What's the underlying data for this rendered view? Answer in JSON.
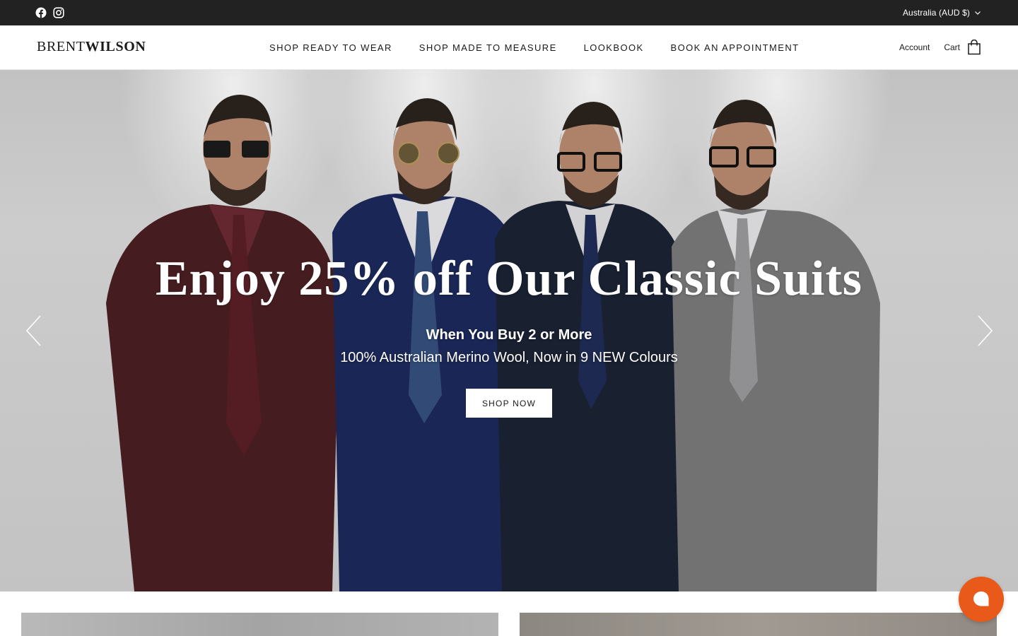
{
  "topbar": {
    "social": [
      {
        "icon": "facebook-icon"
      },
      {
        "icon": "instagram-icon"
      }
    ],
    "locale_label": "Australia (AUD $)"
  },
  "header": {
    "logo_part1": "BRENT",
    "logo_part2": "WILSON",
    "nav": [
      {
        "label": "SHOP READY TO WEAR"
      },
      {
        "label": "SHOP MADE TO MEASURE"
      },
      {
        "label": "LOOKBOOK"
      },
      {
        "label": "BOOK AN APPOINTMENT"
      }
    ],
    "account_label": "Account",
    "cart_label": "Cart"
  },
  "hero": {
    "title": "Enjoy 25% off Our Classic Suits",
    "subtitle": "When You Buy 2 or More",
    "subtitle2": "100% Australian Merino Wool, Now in 9 NEW Colours",
    "cta_label": "SHOP NOW",
    "suit_colors": [
      "#4a1f22",
      "#1c2a5c",
      "#1b2233",
      "#7a7a7a"
    ]
  },
  "colors": {
    "topbar_bg": "#222222",
    "chat_bubble": "#e8591a"
  }
}
